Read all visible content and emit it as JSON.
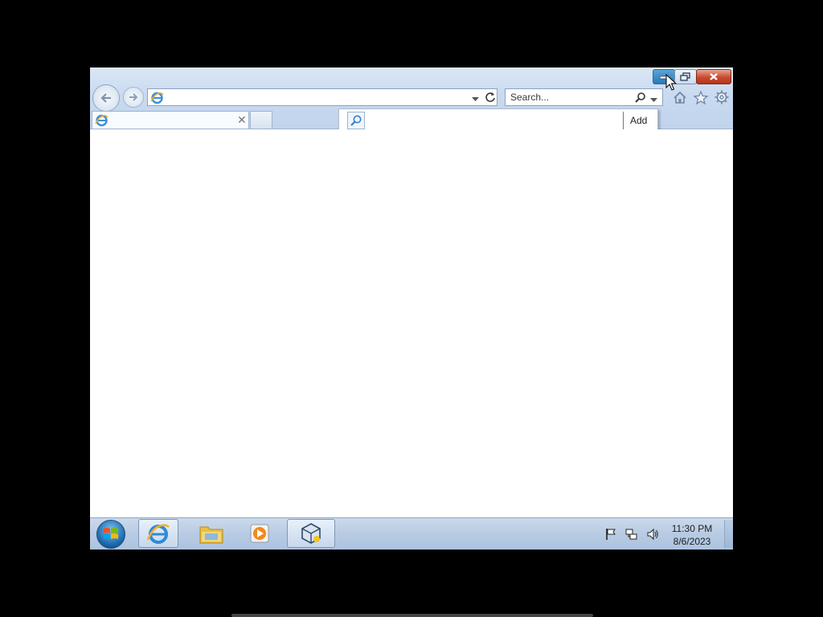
{
  "window": {
    "address": {
      "value": ""
    },
    "search": {
      "placeholder": "Search..."
    },
    "tab": {
      "title": ""
    },
    "find": {
      "value": "",
      "add_label": "Add"
    },
    "caption_buttons": [
      "minimize-icon",
      "restore-icon",
      "close-icon"
    ],
    "toolbar_icons": [
      "home-icon",
      "favorites-star-icon",
      "gear-icon"
    ]
  },
  "taskbar": {
    "pinned": [
      "internet-explorer-icon",
      "file-explorer-icon",
      "media-player-icon",
      "virtualbox-icon"
    ],
    "clock": {
      "time": "11:30 PM",
      "date": "8/6/2023"
    },
    "tray_icons": [
      "action-center-flag-icon",
      "network-icon",
      "volume-icon"
    ]
  },
  "colors": {
    "chrome_top": "#dbe7f5",
    "taskbar": "#b8cbe3",
    "close_button": "#c84a2e",
    "minimize_active": "#2a78b8"
  }
}
